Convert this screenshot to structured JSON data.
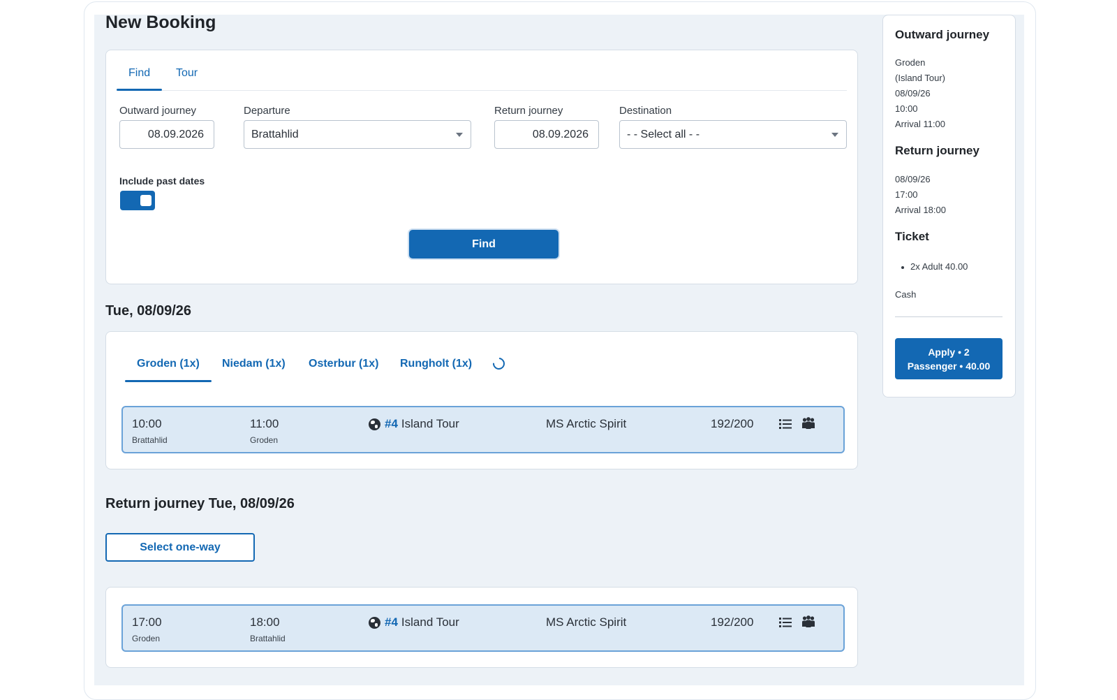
{
  "page": {
    "title": "New Booking"
  },
  "search": {
    "tabs": [
      {
        "label": "Find"
      },
      {
        "label": "Tour"
      }
    ],
    "outward_label": "Outward journey",
    "outward_value": "08.09.2026",
    "departure_label": "Departure",
    "departure_value": "Brattahlid",
    "return_label": "Return journey",
    "return_value": "08.09.2026",
    "destination_label": "Destination",
    "destination_value": "- - Select all - -",
    "past_dates_label": "Include past dates",
    "past_dates_on": true,
    "find_label": "Find"
  },
  "outward_results": {
    "date_title": "Tue, 08/09/26",
    "tabs": [
      {
        "label": "Groden (1x)"
      },
      {
        "label": "Niedam (1x)"
      },
      {
        "label": "Osterbur (1x)"
      },
      {
        "label": "Rungholt (1x)"
      }
    ],
    "rows": [
      {
        "dep_time": "10:00",
        "dep_place": "Brattahlid",
        "arr_time": "11:00",
        "arr_place": "Groden",
        "tour_number": "#4",
        "tour_name": "Island Tour",
        "ship": "MS Arctic Spirit",
        "capacity": "192/200"
      }
    ]
  },
  "return_results": {
    "title": "Return journey Tue, 08/09/26",
    "oneway_label": "Select one-way",
    "rows": [
      {
        "dep_time": "17:00",
        "dep_place": "Groden",
        "arr_time": "18:00",
        "arr_place": "Brattahlid",
        "tour_number": "#4",
        "tour_name": "Island Tour",
        "ship": "MS Arctic Spirit",
        "capacity": "192/200"
      }
    ]
  },
  "summary": {
    "outward_title": "Outward journey",
    "outward_lines": [
      "Groden",
      "(Island Tour)",
      "08/09/26",
      "10:00",
      "Arrival 11:00"
    ],
    "return_title": "Return journey",
    "return_lines": [
      "08/09/26",
      "17:00",
      "Arrival 18:00"
    ],
    "ticket_title": "Ticket",
    "ticket_items": [
      "2x Adult 40.00"
    ],
    "payment": "Cash",
    "apply_line1": "Apply • 2",
    "apply_line2": "Passenger • 40.00"
  },
  "icons": {
    "row_list": "list-icon",
    "row_passengers": "people-icon",
    "tour": "globe-icon",
    "loading": "spinner-icon"
  },
  "colors": {
    "accent": "#1368b3",
    "row_bg": "#dce9f5",
    "page_bg": "#edf2f7"
  }
}
